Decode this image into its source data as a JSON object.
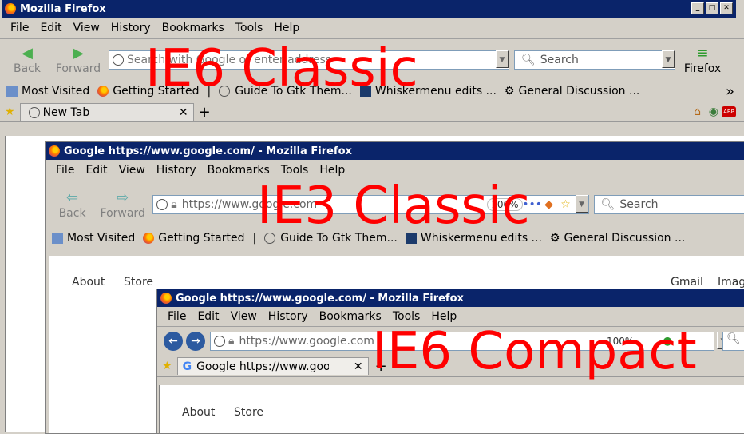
{
  "windows": {
    "w1": {
      "title": "Mozilla Firefox",
      "menu": [
        "File",
        "Edit",
        "View",
        "History",
        "Bookmarks",
        "Tools",
        "Help"
      ],
      "back_label": "Back",
      "forward_label": "Forward",
      "url_placeholder": "Search with Google or enter address",
      "search_placeholder": "Search",
      "firefox_label": "Firefox",
      "bookmarks": [
        "Most Visited",
        "Getting Started",
        "Guide To Gtk Them...",
        "Whiskermenu edits ...",
        "General Discussion ..."
      ],
      "tab_label": "New Tab"
    },
    "w2": {
      "title": "Google https://www.google.com/ - Mozilla Firefox",
      "menu": [
        "File",
        "Edit",
        "View",
        "History",
        "Bookmarks",
        "Tools",
        "Help"
      ],
      "back_label": "Back",
      "forward_label": "Forward",
      "url": "https://www.google.com",
      "zoom": "100%",
      "search_placeholder": "Search",
      "bookmarks": [
        "Most Visited",
        "Getting Started",
        "Guide To Gtk Them...",
        "Whiskermenu edits ...",
        "General Discussion ..."
      ],
      "page_links": [
        "About",
        "Store",
        "Gmail",
        "Images"
      ]
    },
    "w3": {
      "title": "Google https://www.google.com/ - Mozilla Firefox",
      "menu": [
        "File",
        "Edit",
        "View",
        "History",
        "Bookmarks",
        "Tools",
        "Help"
      ],
      "url": "https://www.google.com",
      "zoom": "100%",
      "tab_label": "Google https://www.google.com/",
      "page_links": [
        "About",
        "Store"
      ]
    }
  },
  "overlays": {
    "o1": "IE6 Classic",
    "o2": "IE3 Classic",
    "o3": "IE6 Compact"
  },
  "colors": {
    "titlebar": "#0a246a",
    "overlay_text": "#ff0000",
    "chrome": "#d4d0c8"
  }
}
